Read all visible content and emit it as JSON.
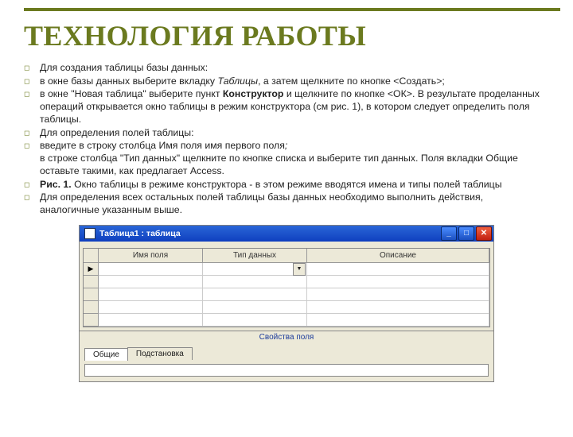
{
  "title": "ТЕХНОЛОГИЯ РАБОТЫ",
  "bullets": [
    {
      "text": "Для создания таблицы базы данных:"
    },
    {
      "html": "в окне базы данных выберите вкладку <span class='em-it'>Таблицы</span>,  а затем щелкните по кнопке &lt;Создать&gt;;"
    },
    {
      "html": "в окне \"Новая таблица\" выберите пункт <span class='em-bd'>Конструктор</span> и щелкните по кнопке &lt;ОК&gt;. В результате проделанных операций открывается окно таблицы в режим конструктора (см рис. 1), в котором следует определить поля таблицы."
    },
    {
      "html": "Для определения полей таблицы:"
    },
    {
      "html": "введите в строку столбца Имя поля имя первого поля<span class='em-it'>;</span><br>в строке столбца \"Тип данных\" щелкните по кнопке списка и выберите тип данных. Поля вкладки Общие оставьте такими, как предлагает Access."
    },
    {
      "html": "<span class='em-bd'>Рис. 1.</span> Окно таблицы в режиме конструктора - в этом режиме вводятся имена и типы полей таблицы"
    },
    {
      "html": "Для определения всех остальных полей таблицы базы данных необходимо выполнить действия, аналогичные указанным выше."
    }
  ],
  "figure": {
    "window_title": "Таблица1 : таблица",
    "columns": [
      "Имя поля",
      "Тип данных",
      "Описание"
    ],
    "rows": 5,
    "active_row_marker": "▶",
    "dropdown_marker": "▼",
    "props_header": "Свойства поля",
    "tabs": [
      "Общие",
      "Подстановка"
    ],
    "active_tab": 0,
    "win_min": "_",
    "win_max": "□",
    "win_close": "✕"
  }
}
